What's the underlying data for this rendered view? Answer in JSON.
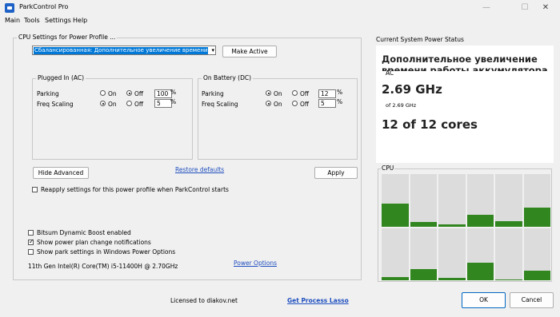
{
  "window": {
    "title": "ParkControl Pro",
    "minimize_glyph": "—",
    "maximize_glyph": "☐",
    "close_glyph": "✕"
  },
  "menu": [
    "Main",
    "Tools",
    "Settings",
    "Help"
  ],
  "cpu_settings": {
    "group_title": "CPU Settings for Power Profile ...",
    "selected_profile": "Сбалансированная: Дополнительное увеличение времени работы аккумулятора",
    "make_active_label": "Make Active",
    "plugged_in": {
      "title": "Plugged In (AC)",
      "parking_label": "Parking",
      "freq_label": "Freq Scaling",
      "on_label": "On",
      "off_label": "Off",
      "parking_selected": "Off",
      "parking_value": "100",
      "freq_selected": "On",
      "freq_value": "5",
      "unit": "%"
    },
    "on_battery": {
      "title": "On Battery (DC)",
      "parking_label": "Parking",
      "freq_label": "Freq Scaling",
      "on_label": "On",
      "off_label": "Off",
      "parking_selected": "On",
      "parking_value": "12",
      "freq_selected": "On",
      "freq_value": "5",
      "unit": "%"
    },
    "hide_advanced_label": "Hide Advanced",
    "restore_defaults_label": "Restore defaults",
    "apply_label": "Apply",
    "reapply_label": "Reapply settings for this power profile when ParkControl starts",
    "reapply_checked": false
  },
  "options": [
    {
      "label": "Bitsum Dynamic Boost enabled",
      "checked": false
    },
    {
      "label": "Show power plan change notifications",
      "checked": true
    },
    {
      "label": "Show park settings in Windows Power Options",
      "checked": false
    }
  ],
  "cpu_name": "11th Gen Intel(R) Core(TM) i5-11400H @ 2.70GHz",
  "power_options_label": "Power Options",
  "status": {
    "title": "Current System Power Status",
    "plan_name": "Дополнительное увеличение времени работы аккумулятора",
    "source": "AC",
    "frequency": "2.69 GHz",
    "frequency_sub": "of 2.69 GHz",
    "cores": "12 of 12 cores"
  },
  "cpu_graph": {
    "title": "CPU",
    "fill_color": "#31861f",
    "core_loads_percent": [
      44,
      8,
      4,
      22,
      10,
      36,
      6,
      22,
      4,
      34,
      2,
      18
    ]
  },
  "footer": {
    "licensed_to": "Licensed to diakov.net",
    "get_process_lasso": "Get Process Lasso",
    "ok_label": "OK",
    "cancel_label": "Cancel"
  }
}
